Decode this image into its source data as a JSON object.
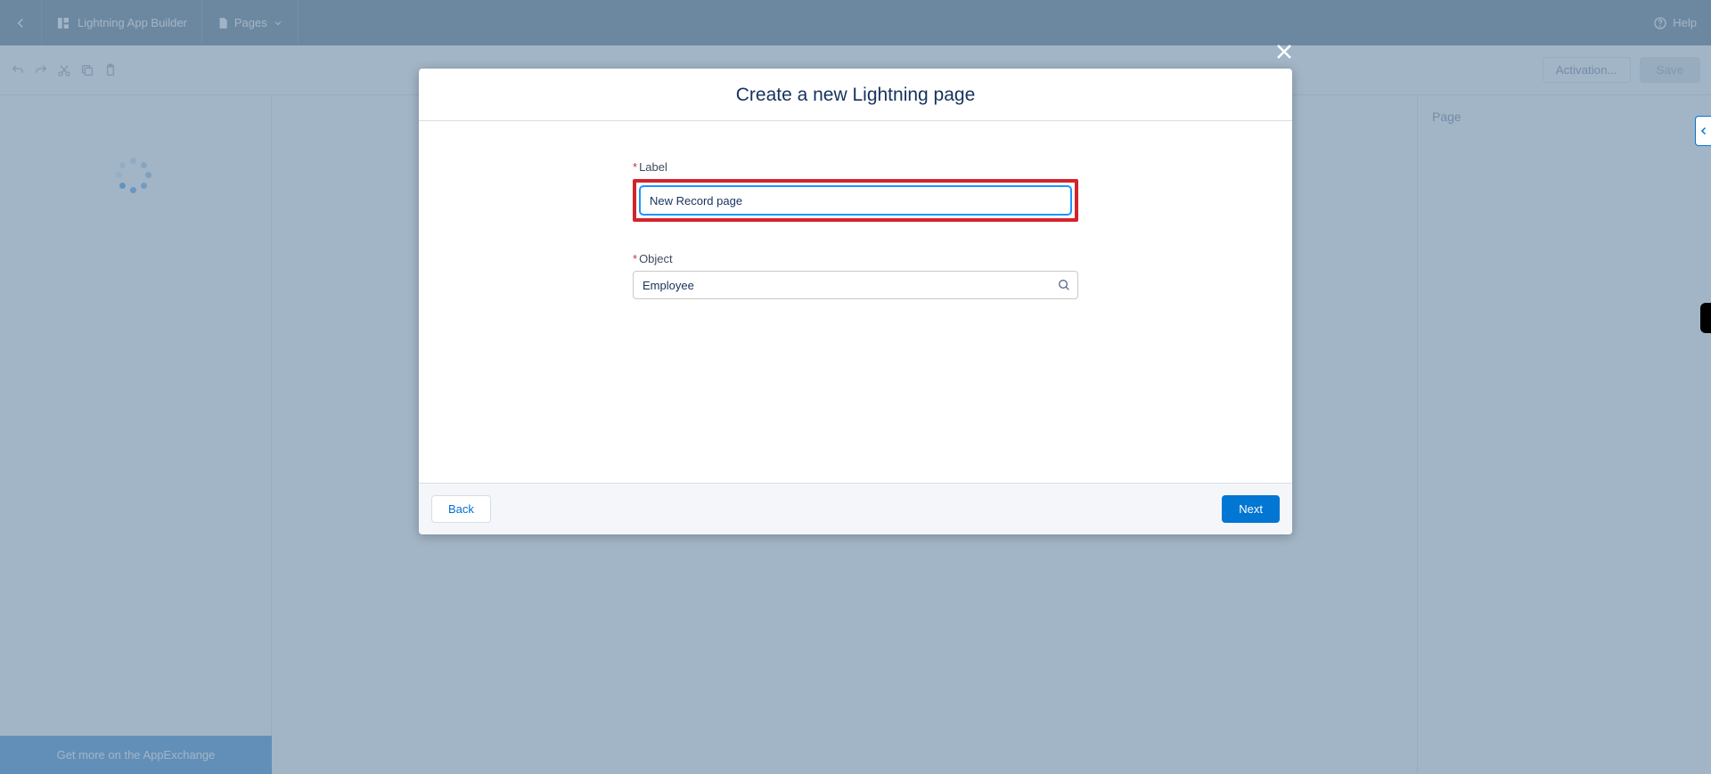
{
  "header": {
    "app_title": "Lightning App Builder",
    "pages_label": "Pages",
    "help_label": "Help"
  },
  "toolbar": {
    "activation_label": "Activation...",
    "save_label": "Save"
  },
  "right_panel": {
    "heading": "Page"
  },
  "appexchange": {
    "cta": "Get more on the AppExchange"
  },
  "modal": {
    "title": "Create a new Lightning page",
    "label_field": {
      "label": "Label",
      "value": "New Record page"
    },
    "object_field": {
      "label": "Object",
      "value": "Employee"
    },
    "back_label": "Back",
    "next_label": "Next"
  },
  "required_marker": "*"
}
